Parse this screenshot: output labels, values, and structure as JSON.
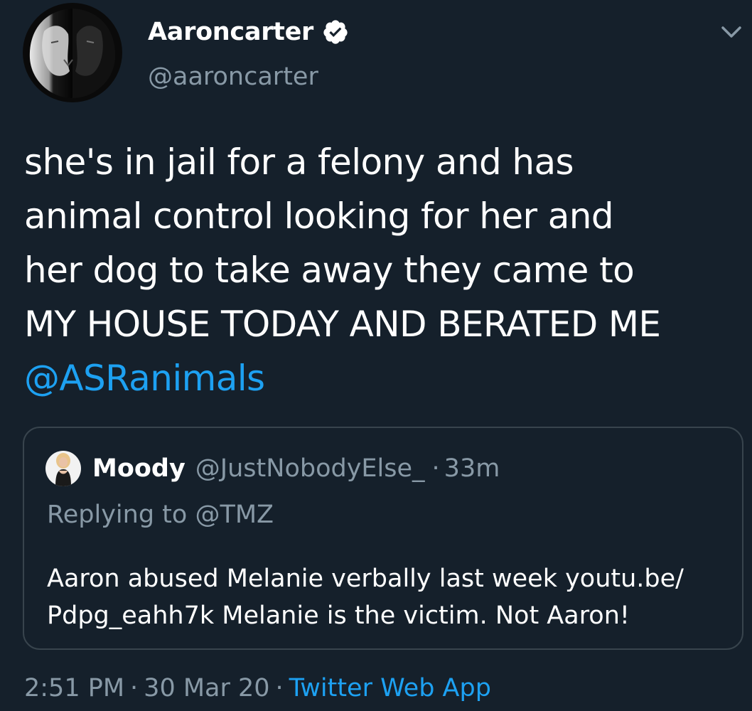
{
  "author": {
    "display_name": "Aaroncarter",
    "handle": "@aaroncarter",
    "verified": true,
    "avatar_icon": "lion-avatar-icon"
  },
  "tweet": {
    "lines": [
      "she's in jail for a felony and has",
      "animal control looking for her and",
      "her dog to take away they came to",
      "MY HOUSE TODAY AND BERATED ME"
    ],
    "mention": "@ASRanimals"
  },
  "quoted_tweet": {
    "display_name": "Moody",
    "handle": "@JustNobodyElse_",
    "dot": "·",
    "time": "33m",
    "replying_to": "Replying to @TMZ",
    "body_lines": [
      "Aaron abused Melanie verbally last week youtu.be/",
      "Pdpg_eahh7k Melanie is the victim. Not Aaron!"
    ]
  },
  "meta": {
    "time": "2:51 PM",
    "sep1": "·",
    "date": "30 Mar 20",
    "sep2": "·",
    "source": "Twitter Web App"
  },
  "colors": {
    "background": "#15202b",
    "text": "#ffffff",
    "secondary": "#8899a6",
    "accent": "#1da1f2",
    "border": "#38444d"
  }
}
